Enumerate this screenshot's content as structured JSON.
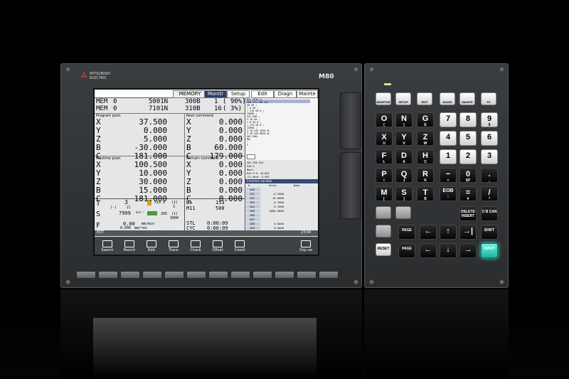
{
  "brand": {
    "name_line1": "MITSUBISHI",
    "name_line2": "ELECTRIC",
    "model": "M80"
  },
  "screen": {
    "top_mode": "MEMORY",
    "tabs": [
      {
        "label": "Monitr",
        "active": true
      },
      {
        "label": "Setup",
        "active": false
      },
      {
        "label": "Edit",
        "active": false
      },
      {
        "label": "Diagn",
        "active": false
      },
      {
        "label": "Mainte",
        "active": false
      }
    ],
    "status_rows": [
      {
        "mode": "MEM",
        "num": "0",
        "prog": "5001N",
        "seq": "300B",
        "a": "1",
        "b": "( 90%)"
      },
      {
        "mode": "MEM",
        "num": "0",
        "prog": "7101N",
        "seq": "310B",
        "a": "16",
        "b": "( 3%)"
      }
    ],
    "program_position_title": "Program posn",
    "next_command_title": "Next command",
    "program_position": [
      {
        "axis": "X",
        "value": "37.500"
      },
      {
        "axis": "Y",
        "value": "0.000"
      },
      {
        "axis": "Z",
        "value": "5.000"
      },
      {
        "axis": "B",
        "value": "-30.000"
      },
      {
        "axis": "C",
        "value": "181.000"
      }
    ],
    "next_command": [
      {
        "axis": "X",
        "value": "0.000"
      },
      {
        "axis": "Y",
        "value": "0.000"
      },
      {
        "axis": "Z",
        "value": "0.000"
      },
      {
        "axis": "B",
        "value": "60.000"
      },
      {
        "axis": "C",
        "value": "179.000"
      }
    ],
    "machine_position_title": "Machine posn",
    "remain_command_title": "Remain command",
    "machine_position": [
      {
        "axis": "X",
        "value": "100.500"
      },
      {
        "axis": "Y",
        "value": "10.000"
      },
      {
        "axis": "Z",
        "value": "30.000"
      },
      {
        "axis": "B",
        "value": "15.000"
      },
      {
        "axis": "C",
        "value": "181.000"
      }
    ],
    "remain_command": [
      {
        "axis": "X",
        "value": "0.000"
      },
      {
        "axis": "Y",
        "value": "0.000"
      },
      {
        "axis": "Z",
        "value": "0.000"
      },
      {
        "axis": "B",
        "value": "0.000"
      },
      {
        "axis": "C",
        "value": "0.000"
      }
    ],
    "tool": {
      "t_label": "T",
      "t_value": "3",
      "t_sub": "(-)",
      "t_sub2": "2)",
      "s_rpm": "7999",
      "s_unit": "min⁻¹",
      "mod1": "×10 0",
      "mod2": "(1)",
      "mod3": "3",
      "mod4": "205",
      "mod5": "(1)",
      "mod6": "3000"
    },
    "feed": {
      "f_label": "F",
      "value": "0.00",
      "unit": "mm/min",
      "sub": "0.000",
      "sub_unit": "mm/rev"
    },
    "wk": {
      "wk_label": "Wk",
      "wk_value": "153",
      "m_label": "M11",
      "m_value": "500"
    },
    "time": {
      "stl_label": "STL",
      "stl_value": "0:00:09",
      "cyc_label": "CYC",
      "cyc_value": "0:00:09"
    },
    "bottom_left": "EDT",
    "bottom_right": "23:00",
    "program_text": [
      "N32 S650 O;",
      "G80 G91 G28 Z0;",
      "G0 X0 ;",
      "(-5 G0 ;",
      "(-1?8 G0 0 ;",
      "CUR90 ;",
      "",
      "X43 G00 ;",
      "Z-10 G0 ;",
      "2-8 G0 0 ;",
      "(-170 G0 0 ;",
      "CUR90 ;",
      "",
      "Z-10 X43 Z035 B;",
      "Z-10 X43 B020 B;",
      "G01 G00;",
      "M0;",
      ";",
      "%"
    ],
    "modal_lines": [
      "G01  G90 G54",
      "G40  G",
      "Near:",
      "H45  H  D:   20-092",
      "(2)  Near:   0 092"
    ],
    "common_variable_title": "Common variable",
    "common_variable_headers": [
      "#",
      "Value",
      "Name"
    ],
    "common_variables": [
      {
        "n": "100",
        "v": ""
      },
      {
        "n": "101",
        "v": "-0.2000"
      },
      {
        "n": "102",
        "v": "10.0000"
      },
      {
        "n": "103",
        "v": "0.7000"
      },
      {
        "n": "104",
        "v": "0.7000"
      },
      {
        "n": "105",
        "v": "3000.0000"
      },
      {
        "n": "106",
        "v": ""
      },
      {
        "n": "107",
        "v": ""
      },
      {
        "n": "108",
        "v": "0.0000"
      },
      {
        "n": "109",
        "v": "0.0000"
      }
    ],
    "menu": [
      "Search",
      "Resrch",
      "Edit",
      "Trace",
      "Check",
      "Offset",
      "Coord",
      "",
      "",
      "Dsp sw"
    ]
  },
  "keypad": {
    "func_keys": [
      "MONITOR",
      "SETUP",
      "EDIT",
      "DIAGN",
      "MAINTE",
      "F0"
    ],
    "alpha_rows": [
      [
        {
          "big": "O",
          "small": "("
        },
        {
          "big": "N",
          "small": ")"
        },
        {
          "big": "G",
          "small": "E"
        }
      ],
      [
        {
          "big": "X",
          "small": "U"
        },
        {
          "big": "Y",
          "small": "V"
        },
        {
          "big": "Z",
          "small": "W"
        }
      ],
      [
        {
          "big": "F",
          "small": "L"
        },
        {
          "big": "D",
          "small": "A"
        },
        {
          "big": "H",
          "small": "C"
        }
      ],
      [
        {
          "big": "P",
          "small": "I"
        },
        {
          "big": "Q",
          "small": "J"
        },
        {
          "big": "R",
          "small": "K"
        }
      ],
      [
        {
          "big": "M",
          "small": "["
        },
        {
          "big": "S",
          "small": "]"
        },
        {
          "big": "T",
          "small": "B"
        }
      ]
    ],
    "num_rows": [
      [
        {
          "big": "7",
          "small": ""
        },
        {
          "big": "8",
          "small": ""
        },
        {
          "big": "9",
          "small": "$"
        }
      ],
      [
        {
          "big": "4",
          "small": ""
        },
        {
          "big": "5",
          "small": ""
        },
        {
          "big": "6",
          "small": ""
        }
      ],
      [
        {
          "big": "1",
          "small": ""
        },
        {
          "big": "2",
          "small": ""
        },
        {
          "big": "3",
          "small": ""
        }
      ],
      [
        {
          "big": "−",
          "small": "+"
        },
        {
          "big": "0",
          "small": "SP"
        },
        {
          "big": ".",
          "small": ","
        }
      ],
      [
        {
          "big": "EOB",
          "small": ";"
        },
        {
          "big": "=",
          "small": "#"
        },
        {
          "big": "/",
          "small": "*"
        }
      ]
    ],
    "delete_label": "DELETE INSERT",
    "cb_label": "C·B CAN",
    "shift_label": "SHIFT",
    "reset_label": "RESET",
    "input_label": "INPUT",
    "page_label": "PAGE"
  }
}
